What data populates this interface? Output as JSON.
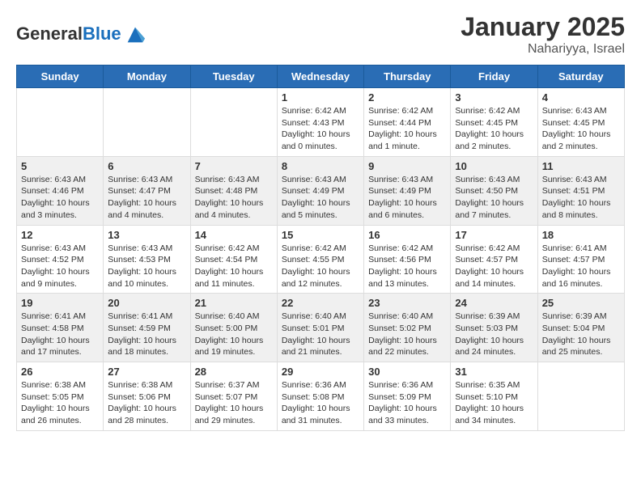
{
  "header": {
    "logo_general": "General",
    "logo_blue": "Blue",
    "title": "January 2025",
    "subtitle": "Nahariyya, Israel"
  },
  "calendar": {
    "days_of_week": [
      "Sunday",
      "Monday",
      "Tuesday",
      "Wednesday",
      "Thursday",
      "Friday",
      "Saturday"
    ],
    "weeks": [
      {
        "cells": [
          {
            "day": "",
            "info": ""
          },
          {
            "day": "",
            "info": ""
          },
          {
            "day": "",
            "info": ""
          },
          {
            "day": "1",
            "info": "Sunrise: 6:42 AM\nSunset: 4:43 PM\nDaylight: 10 hours\nand 0 minutes."
          },
          {
            "day": "2",
            "info": "Sunrise: 6:42 AM\nSunset: 4:44 PM\nDaylight: 10 hours\nand 1 minute."
          },
          {
            "day": "3",
            "info": "Sunrise: 6:42 AM\nSunset: 4:45 PM\nDaylight: 10 hours\nand 2 minutes."
          },
          {
            "day": "4",
            "info": "Sunrise: 6:43 AM\nSunset: 4:45 PM\nDaylight: 10 hours\nand 2 minutes."
          }
        ]
      },
      {
        "cells": [
          {
            "day": "5",
            "info": "Sunrise: 6:43 AM\nSunset: 4:46 PM\nDaylight: 10 hours\nand 3 minutes."
          },
          {
            "day": "6",
            "info": "Sunrise: 6:43 AM\nSunset: 4:47 PM\nDaylight: 10 hours\nand 4 minutes."
          },
          {
            "day": "7",
            "info": "Sunrise: 6:43 AM\nSunset: 4:48 PM\nDaylight: 10 hours\nand 4 minutes."
          },
          {
            "day": "8",
            "info": "Sunrise: 6:43 AM\nSunset: 4:49 PM\nDaylight: 10 hours\nand 5 minutes."
          },
          {
            "day": "9",
            "info": "Sunrise: 6:43 AM\nSunset: 4:49 PM\nDaylight: 10 hours\nand 6 minutes."
          },
          {
            "day": "10",
            "info": "Sunrise: 6:43 AM\nSunset: 4:50 PM\nDaylight: 10 hours\nand 7 minutes."
          },
          {
            "day": "11",
            "info": "Sunrise: 6:43 AM\nSunset: 4:51 PM\nDaylight: 10 hours\nand 8 minutes."
          }
        ]
      },
      {
        "cells": [
          {
            "day": "12",
            "info": "Sunrise: 6:43 AM\nSunset: 4:52 PM\nDaylight: 10 hours\nand 9 minutes."
          },
          {
            "day": "13",
            "info": "Sunrise: 6:43 AM\nSunset: 4:53 PM\nDaylight: 10 hours\nand 10 minutes."
          },
          {
            "day": "14",
            "info": "Sunrise: 6:42 AM\nSunset: 4:54 PM\nDaylight: 10 hours\nand 11 minutes."
          },
          {
            "day": "15",
            "info": "Sunrise: 6:42 AM\nSunset: 4:55 PM\nDaylight: 10 hours\nand 12 minutes."
          },
          {
            "day": "16",
            "info": "Sunrise: 6:42 AM\nSunset: 4:56 PM\nDaylight: 10 hours\nand 13 minutes."
          },
          {
            "day": "17",
            "info": "Sunrise: 6:42 AM\nSunset: 4:57 PM\nDaylight: 10 hours\nand 14 minutes."
          },
          {
            "day": "18",
            "info": "Sunrise: 6:41 AM\nSunset: 4:57 PM\nDaylight: 10 hours\nand 16 minutes."
          }
        ]
      },
      {
        "cells": [
          {
            "day": "19",
            "info": "Sunrise: 6:41 AM\nSunset: 4:58 PM\nDaylight: 10 hours\nand 17 minutes."
          },
          {
            "day": "20",
            "info": "Sunrise: 6:41 AM\nSunset: 4:59 PM\nDaylight: 10 hours\nand 18 minutes."
          },
          {
            "day": "21",
            "info": "Sunrise: 6:40 AM\nSunset: 5:00 PM\nDaylight: 10 hours\nand 19 minutes."
          },
          {
            "day": "22",
            "info": "Sunrise: 6:40 AM\nSunset: 5:01 PM\nDaylight: 10 hours\nand 21 minutes."
          },
          {
            "day": "23",
            "info": "Sunrise: 6:40 AM\nSunset: 5:02 PM\nDaylight: 10 hours\nand 22 minutes."
          },
          {
            "day": "24",
            "info": "Sunrise: 6:39 AM\nSunset: 5:03 PM\nDaylight: 10 hours\nand 24 minutes."
          },
          {
            "day": "25",
            "info": "Sunrise: 6:39 AM\nSunset: 5:04 PM\nDaylight: 10 hours\nand 25 minutes."
          }
        ]
      },
      {
        "cells": [
          {
            "day": "26",
            "info": "Sunrise: 6:38 AM\nSunset: 5:05 PM\nDaylight: 10 hours\nand 26 minutes."
          },
          {
            "day": "27",
            "info": "Sunrise: 6:38 AM\nSunset: 5:06 PM\nDaylight: 10 hours\nand 28 minutes."
          },
          {
            "day": "28",
            "info": "Sunrise: 6:37 AM\nSunset: 5:07 PM\nDaylight: 10 hours\nand 29 minutes."
          },
          {
            "day": "29",
            "info": "Sunrise: 6:36 AM\nSunset: 5:08 PM\nDaylight: 10 hours\nand 31 minutes."
          },
          {
            "day": "30",
            "info": "Sunrise: 6:36 AM\nSunset: 5:09 PM\nDaylight: 10 hours\nand 33 minutes."
          },
          {
            "day": "31",
            "info": "Sunrise: 6:35 AM\nSunset: 5:10 PM\nDaylight: 10 hours\nand 34 minutes."
          },
          {
            "day": "",
            "info": ""
          }
        ]
      }
    ]
  }
}
